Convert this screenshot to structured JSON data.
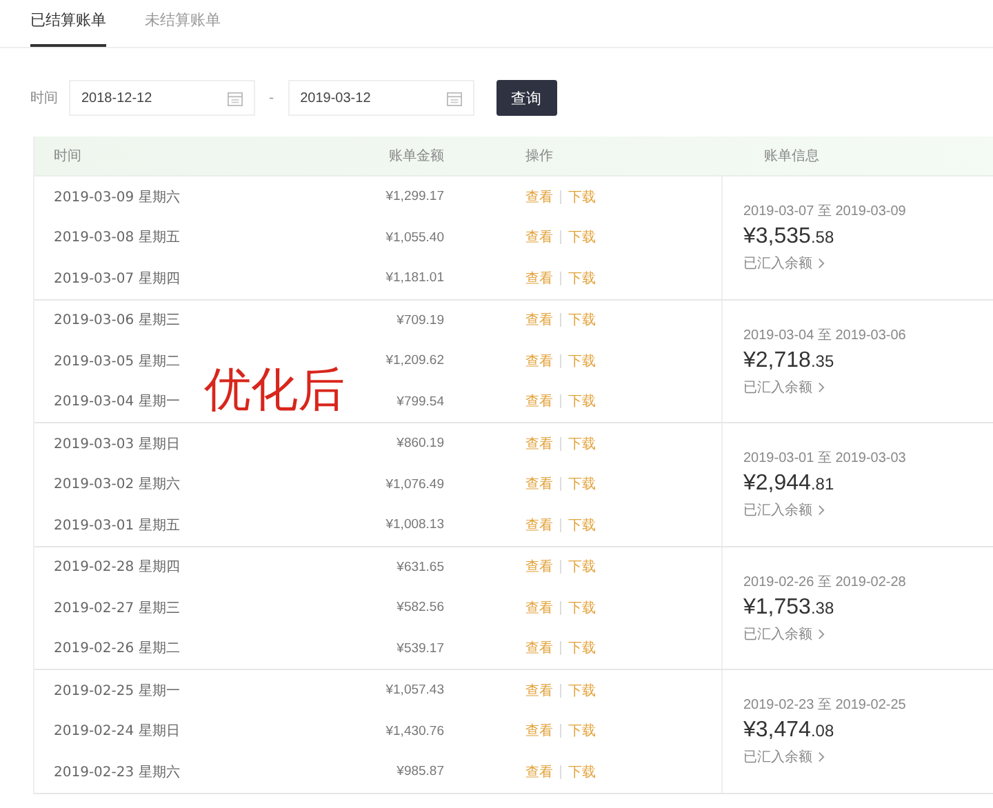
{
  "tabs": [
    {
      "label": "已结算账单",
      "selected": true
    },
    {
      "label": "未结算账单",
      "selected": false
    }
  ],
  "filter": {
    "label": "时间",
    "start": "2018-12-12",
    "separator": "-",
    "end": "2019-03-12",
    "button": "查询"
  },
  "table": {
    "columns": [
      "时间",
      "账单金额",
      "操作",
      "账单信息"
    ],
    "groups": [
      {
        "rows": [
          {
            "date": "2019-03-09 星期六",
            "amount": "¥1,299.17",
            "actions": [
              "查看",
              "下载"
            ]
          },
          {
            "date": "2019-03-08 星期五",
            "amount": "¥1,055.40",
            "actions": [
              "查看",
              "下载"
            ]
          },
          {
            "date": "2019-03-07 星期四",
            "amount": "¥1,181.01",
            "actions": [
              "查看",
              "下载"
            ]
          }
        ],
        "period": "2019-03-07 至 2019-03-09",
        "total": "¥3,535",
        "total_decimals": ".58",
        "status": "已汇入余额"
      },
      {
        "rows": [
          {
            "date": "2019-03-06 星期三",
            "amount": "¥709.19",
            "actions": [
              "查看",
              "下载"
            ]
          },
          {
            "date": "2019-03-05 星期二",
            "amount": "¥1,209.62",
            "actions": [
              "查看",
              "下载"
            ]
          },
          {
            "date": "2019-03-04 星期一",
            "amount": "¥799.54",
            "actions": [
              "查看",
              "下载"
            ]
          }
        ],
        "period": "2019-03-04 至 2019-03-06",
        "total": "¥2,718",
        "total_decimals": ".35",
        "status": "已汇入余额"
      },
      {
        "rows": [
          {
            "date": "2019-03-03 星期日",
            "amount": "¥860.19",
            "actions": [
              "查看",
              "下载"
            ]
          },
          {
            "date": "2019-03-02 星期六",
            "amount": "¥1,076.49",
            "actions": [
              "查看",
              "下载"
            ]
          },
          {
            "date": "2019-03-01 星期五",
            "amount": "¥1,008.13",
            "actions": [
              "查看",
              "下载"
            ]
          }
        ],
        "period": "2019-03-01 至 2019-03-03",
        "total": "¥2,944",
        "total_decimals": ".81",
        "status": "已汇入余额"
      },
      {
        "rows": [
          {
            "date": "2019-02-28 星期四",
            "amount": "¥631.65",
            "actions": [
              "查看",
              "下载"
            ]
          },
          {
            "date": "2019-02-27 星期三",
            "amount": "¥582.56",
            "actions": [
              "查看",
              "下载"
            ]
          },
          {
            "date": "2019-02-26 星期二",
            "amount": "¥539.17",
            "actions": [
              "查看",
              "下载"
            ]
          }
        ],
        "period": "2019-02-26 至 2019-02-28",
        "total": "¥1,753",
        "total_decimals": ".38",
        "status": "已汇入余额"
      },
      {
        "rows": [
          {
            "date": "2019-02-25 星期一",
            "amount": "¥1,057.43",
            "actions": [
              "查看",
              "下载"
            ]
          },
          {
            "date": "2019-02-24 星期日",
            "amount": "¥1,430.76",
            "actions": [
              "查看",
              "下载"
            ]
          },
          {
            "date": "2019-02-23 星期六",
            "amount": "¥985.87",
            "actions": [
              "查看",
              "下载"
            ]
          }
        ],
        "period": "2019-02-23 至 2019-02-25",
        "total": "¥3,474",
        "total_decimals": ".08",
        "status": "已汇入余额"
      }
    ]
  },
  "annotation": "优化后"
}
